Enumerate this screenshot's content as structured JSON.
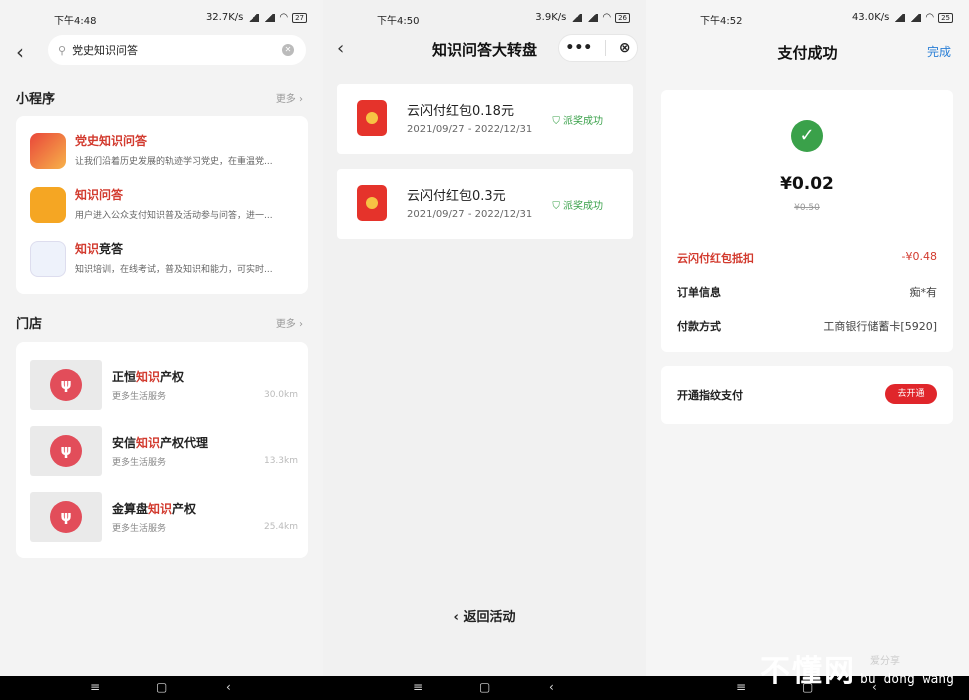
{
  "panel1": {
    "status": {
      "time": "下午4:48",
      "speed": "32.7K/s",
      "battery": "27"
    },
    "search": {
      "value": "党史知识问答"
    },
    "miniprograms": {
      "title": "小程序",
      "more": "更多",
      "items": [
        {
          "name_hl": "党史知识问答",
          "name_rest": "",
          "desc": "让我们沿着历史发展的轨迹学习党史，在重温党..."
        },
        {
          "name_hl": "知识问答",
          "name_rest": "",
          "desc": "用户进入公众支付知识普及活动参与问答，进一..."
        },
        {
          "name_hl": "知识",
          "name_rest": "竞答",
          "desc": "知识培训，在线考试，普及知识和能力，可实时..."
        }
      ]
    },
    "stores": {
      "title": "门店",
      "more": "更多",
      "items": [
        {
          "pre": "正恒",
          "hl": "知识",
          "post": "产权",
          "sub": "更多生活服务",
          "dist": "30.0km"
        },
        {
          "pre": "安信",
          "hl": "知识",
          "post": "产权代理",
          "sub": "更多生活服务",
          "dist": "13.3km"
        },
        {
          "pre": "金算盘",
          "hl": "知识",
          "post": "产权",
          "sub": "更多生活服务",
          "dist": "25.4km"
        }
      ]
    }
  },
  "panel2": {
    "status": {
      "time": "下午4:50",
      "speed": "3.9K/s",
      "battery": "26"
    },
    "title": "知识问答大转盘",
    "capsule_more": "•••",
    "capsule_close": "⊗",
    "rewards": [
      {
        "title": "云闪付红包0.18元",
        "date": "2021/09/27 - 2022/12/31",
        "status": "派奖成功"
      },
      {
        "title": "云闪付红包0.3元",
        "date": "2021/09/27 - 2022/12/31",
        "status": "派奖成功"
      }
    ],
    "return_label": "返回活动"
  },
  "panel3": {
    "status": {
      "time": "下午4:52",
      "speed": "43.0K/s",
      "battery": "25"
    },
    "title": "支付成功",
    "done": "完成",
    "amount": "¥0.02",
    "original": "¥0.50",
    "rows": [
      {
        "k": "云闪付红包抵扣",
        "v": "-¥0.48"
      },
      {
        "k": "订单信息",
        "v": "痴*有"
      },
      {
        "k": "付款方式",
        "v": "工商银行储蓄卡[5920]"
      }
    ],
    "fingerprint": {
      "label": "开通指纹支付",
      "button": "去开通"
    }
  },
  "watermark": {
    "big": "不懂网",
    "small": "爱分享",
    "pinyin": "bu dong wang"
  },
  "colors": {
    "accent_red": "#d23a2e",
    "success_green": "#3aa14a",
    "link_blue": "#2a7fd6"
  }
}
